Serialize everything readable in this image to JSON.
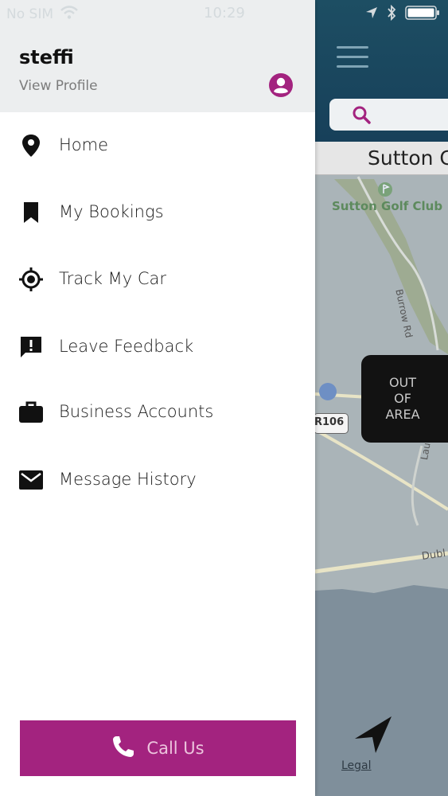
{
  "status_bar": {
    "carrier": "No SIM",
    "time": "10:29",
    "icons": [
      "wifi-icon",
      "location-arrow-icon",
      "bluetooth-icon",
      "battery-icon"
    ]
  },
  "drawer": {
    "user_name": "steffi",
    "view_profile_label": "View Profile",
    "menu": [
      {
        "label": "Home",
        "icon": "location-pin-icon"
      },
      {
        "label": "My Bookings",
        "icon": "bookmark-icon"
      },
      {
        "label": "Track My Car",
        "icon": "gps-target-icon"
      },
      {
        "label": "Leave Feedback",
        "icon": "feedback-icon"
      },
      {
        "label": "Business Accounts",
        "icon": "briefcase-icon"
      },
      {
        "label": "Message History",
        "icon": "envelope-icon"
      }
    ],
    "call_button_label": "Call Us"
  },
  "map": {
    "location_label": "Sutton C",
    "golf_label": "Sutton Golf Club",
    "road_burrow": "Burrow Rd",
    "road_dubl": "Dubl",
    "road_lau": "Lau",
    "road_shield": "R106",
    "out_of_area": "OUT\nOF\nAREA",
    "legal_link": "Legal"
  },
  "colors": {
    "brand": "#a3237f",
    "top_bar": "#1d4e63",
    "drawer_header": "#eceeef"
  }
}
